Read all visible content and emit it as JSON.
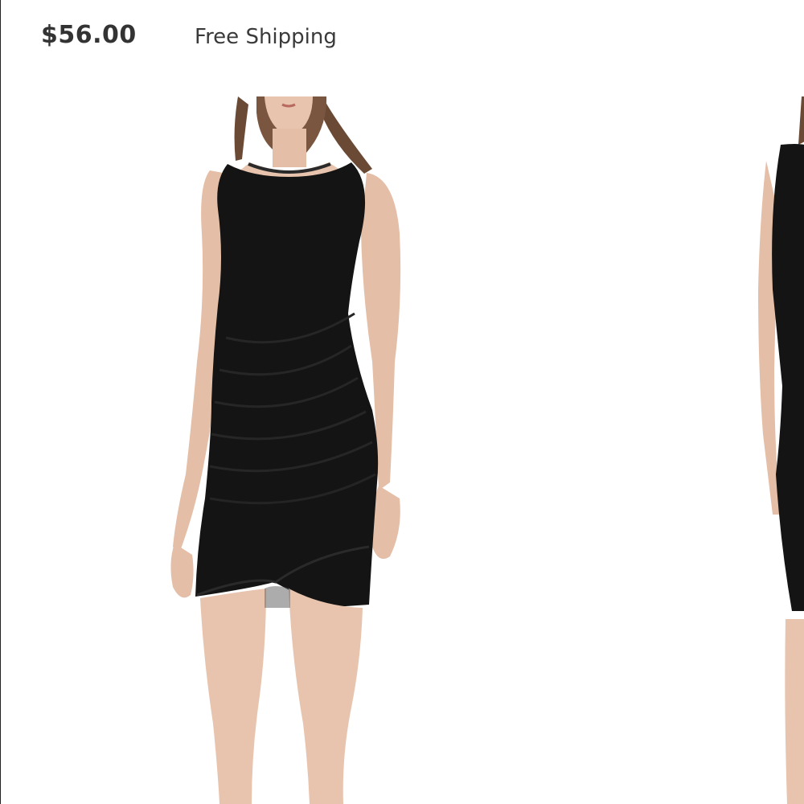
{
  "product": {
    "price": "$56.00",
    "shipping": "Free Shipping"
  },
  "gallery": {
    "images": [
      {
        "name": "product-image-front",
        "description": "woman in black sleeveless ruched dress"
      },
      {
        "name": "product-image-next",
        "description": "partial view of next image"
      }
    ]
  },
  "colors": {
    "dress": "#141414",
    "skin": "#e8c4ae",
    "hair": "#6b4a35",
    "text": "#333333"
  }
}
